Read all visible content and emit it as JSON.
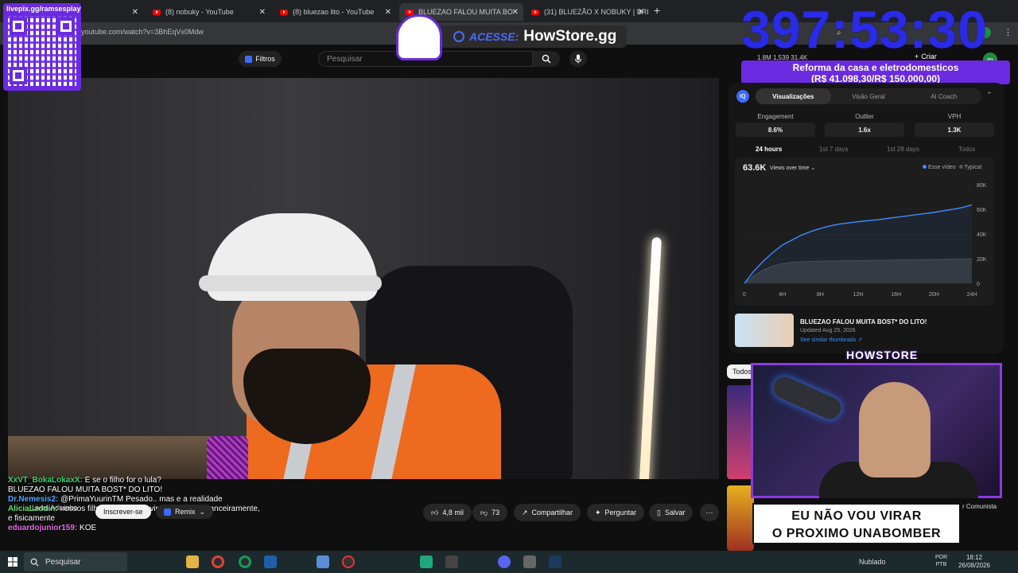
{
  "browser": {
    "tabs": [
      {
        "label": "",
        "active": false
      },
      {
        "label": "(8) nobuky - YouTube",
        "active": false
      },
      {
        "label": "(8) bluezao lito - YouTube",
        "active": false
      },
      {
        "label": "BLUEZAO FALOU MUITA BO",
        "active": true
      },
      {
        "label": "(31) BLUEZÃO X NOBUKY | BRI",
        "active": false
      }
    ],
    "url": "youtube.com/watch?v=3BhEqVx0Mdw"
  },
  "youtube": {
    "filters_label": "Filtros",
    "search_placeholder": "Pesquisar",
    "create_label": "Criar",
    "header_stats": "1.8M   1,539   31.4K",
    "avatar_letter": "m"
  },
  "overlay": {
    "qr_label": "livepix.gg/ramsesplay",
    "acesse_label": "ACESSE:",
    "howstore_url": "HowStore.gg",
    "timer": "397:53:30",
    "goal_line1": "Reforma da casa e eletrodomesticos",
    "goal_line2": "(R$ 41.098,30/R$ 150.000,00)",
    "howstore_badge": "HOWSTORE",
    "cam_text_line1": "EU NÃO VOU VIRAR",
    "cam_text_line2": "O PROXIMO UNABOMBER"
  },
  "chat": [
    {
      "user": "XxVT_BokaLokaxX:",
      "text": " E se o filho for o lula?",
      "cls": "u1"
    },
    {
      "user": "",
      "text": "BLUEZAO FALOU MUITA BOST* DO LITO!",
      "cls": ""
    },
    {
      "user": "Dr.Nemesis2:",
      "text": " @PrimaYuurinTM Pesado.. mas e a realidade",
      "cls": "u2"
    },
    {
      "user": "AliciaLaddin:",
      "text": " nossos filhos tem que se virar sozinhos financeiramente, e fisicamente",
      "cls": "u3"
    },
    {
      "user": "eduardojunior159:",
      "text": " KOE",
      "cls": "u4"
    }
  ],
  "video_actions": {
    "channel_name": "Lives Adivinho",
    "subscribe_label": "Inscrever-se",
    "remix_label": "Remix",
    "likes": "4,8 mil",
    "dislikes": "73",
    "share_label": "Compartilhar",
    "ask_label": "Perguntar",
    "save_label": "Salvar"
  },
  "vidiq": {
    "logo": "IQ",
    "tabs": [
      "Visualizações",
      "Visão Geral",
      "AI Coach"
    ],
    "active_tab": 0,
    "metrics": [
      {
        "label": "Engagement",
        "value": "8.6%"
      },
      {
        "label": "Outlier",
        "value": "1.6x"
      },
      {
        "label": "VPH",
        "value": "1.3K"
      }
    ],
    "ranges": [
      "24 hours",
      "1st 7 days",
      "1st 28 days",
      "Todos"
    ],
    "active_range": 0,
    "views_total": "63.6K",
    "views_selector": "Views over time ⌄",
    "legend_this": "Esse vídeo",
    "legend_typical": "Typical",
    "video_title": "BLUEZAO FALOU MUITA BOST* DO LITO!",
    "updated": "Updated Aug 25, 2026",
    "similar": "See similar thumbnails ↗"
  },
  "chart_data": {
    "type": "area",
    "x": [
      0,
      1,
      2,
      3,
      4,
      5,
      6,
      7,
      8,
      9,
      10,
      11,
      12,
      13,
      14,
      15,
      16,
      17,
      18,
      19,
      20,
      21,
      22,
      23,
      24
    ],
    "x_tick_labels": [
      "0",
      "4H",
      "8H",
      "12H",
      "16H",
      "20H",
      "24H"
    ],
    "y_tick_labels": [
      "0",
      "20K",
      "40K",
      "60K",
      "80K"
    ],
    "ylim": [
      0,
      80000
    ],
    "series": [
      {
        "name": "Esse vídeo",
        "values": [
          0,
          10000,
          18000,
          25000,
          31000,
          35000,
          39000,
          42000,
          44500,
          46500,
          48000,
          49000,
          50000,
          50800,
          51500,
          52500,
          53500,
          54500,
          55500,
          56500,
          57500,
          58800,
          60000,
          61500,
          63600
        ],
        "color": "#3e8bff"
      },
      {
        "name": "Typical",
        "values": [
          0,
          6000,
          11000,
          14000,
          16000,
          17000,
          17500,
          17800,
          18000,
          18100,
          18200,
          18300,
          18400,
          18500,
          18600,
          18700,
          18800,
          18900,
          19000,
          19100,
          19200,
          19300,
          19400,
          19500,
          19600
        ],
        "color": "#3a3a3a"
      }
    ]
  },
  "right_list": {
    "todos_label": "Todos",
    "comunista": "r Comunista"
  },
  "taskbar": {
    "search_label": "Pesquisar",
    "weather": "Nublado",
    "lang1": "POR",
    "lang2": "PTB",
    "time": "18:12",
    "date": "26/08/2026"
  }
}
